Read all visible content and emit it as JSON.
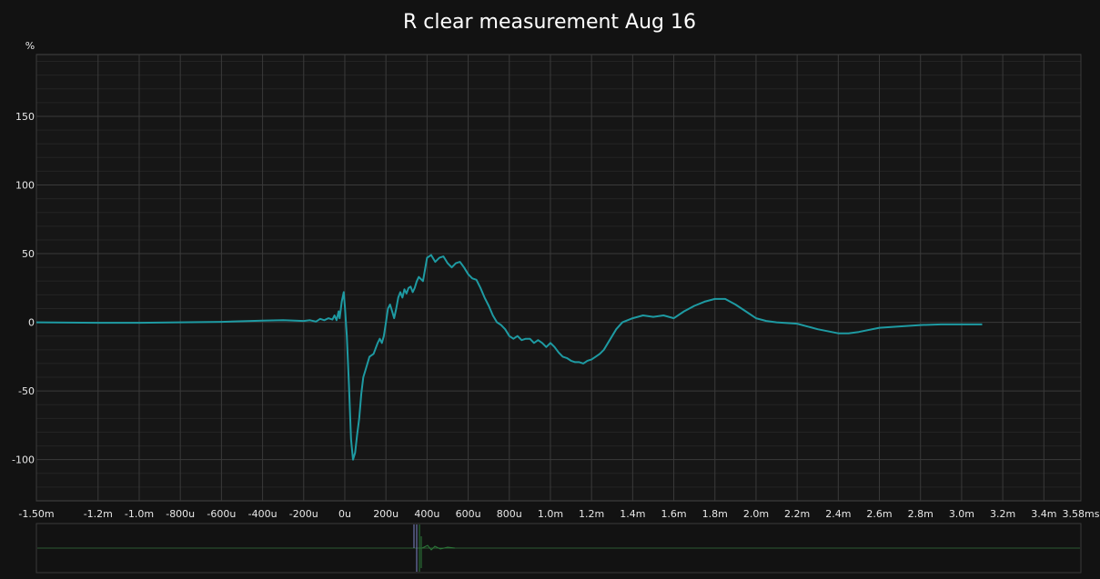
{
  "chart_data": {
    "type": "line",
    "title": "R clear measurement Aug 16",
    "ylabel": "%",
    "xlabel": "",
    "xlim_ms": [
      -1.5,
      3.58
    ],
    "ylim": [
      -130,
      195
    ],
    "grid": true,
    "colors": {
      "background": "#121212",
      "plot_background": "#161616",
      "grid_major": "#3a3a3a",
      "grid_minor": "#242424",
      "line": "#1e9aa2",
      "text": "#e8e8e8",
      "overview_line": "#2c7a3a",
      "overview_marker": "#7d86c8"
    },
    "x_ticks": [
      {
        "v": -1.5,
        "label": "-1.50m"
      },
      {
        "v": -1.2,
        "label": "-1.2m"
      },
      {
        "v": -1.0,
        "label": "-1.0m"
      },
      {
        "v": -0.8,
        "label": "-800u"
      },
      {
        "v": -0.6,
        "label": "-600u"
      },
      {
        "v": -0.4,
        "label": "-400u"
      },
      {
        "v": -0.2,
        "label": "-200u"
      },
      {
        "v": 0.0,
        "label": "0u"
      },
      {
        "v": 0.2,
        "label": "200u"
      },
      {
        "v": 0.4,
        "label": "400u"
      },
      {
        "v": 0.6,
        "label": "600u"
      },
      {
        "v": 0.8,
        "label": "800u"
      },
      {
        "v": 1.0,
        "label": "1.0m"
      },
      {
        "v": 1.2,
        "label": "1.2m"
      },
      {
        "v": 1.4,
        "label": "1.4m"
      },
      {
        "v": 1.6,
        "label": "1.6m"
      },
      {
        "v": 1.8,
        "label": "1.8m"
      },
      {
        "v": 2.0,
        "label": "2.0m"
      },
      {
        "v": 2.2,
        "label": "2.2m"
      },
      {
        "v": 2.4,
        "label": "2.4m"
      },
      {
        "v": 2.6,
        "label": "2.6m"
      },
      {
        "v": 2.8,
        "label": "2.8m"
      },
      {
        "v": 3.0,
        "label": "3.0m"
      },
      {
        "v": 3.2,
        "label": "3.2m"
      },
      {
        "v": 3.4,
        "label": "3.4m"
      },
      {
        "v": 3.58,
        "label": "3.58ms"
      }
    ],
    "y_ticks": [
      {
        "v": 150,
        "label": "150"
      },
      {
        "v": 100,
        "label": "100"
      },
      {
        "v": 50,
        "label": "50"
      },
      {
        "v": 0,
        "label": "0"
      },
      {
        "v": -50,
        "label": "-50"
      },
      {
        "v": -100,
        "label": "-100"
      }
    ],
    "series": [
      {
        "x": [
          -1.5,
          -1.2,
          -1.0,
          -0.6,
          -0.4,
          -0.3,
          -0.2,
          -0.17,
          -0.14,
          -0.12,
          -0.1,
          -0.08,
          -0.06,
          -0.05,
          -0.04,
          -0.03,
          -0.025,
          -0.015,
          -0.005,
          0.0,
          0.01,
          0.02,
          0.03,
          0.04,
          0.05,
          0.06,
          0.07,
          0.08,
          0.09,
          0.1,
          0.12,
          0.14,
          0.16,
          0.17,
          0.18,
          0.19,
          0.2,
          0.21,
          0.22,
          0.23,
          0.24,
          0.25,
          0.26,
          0.27,
          0.28,
          0.29,
          0.3,
          0.31,
          0.32,
          0.33,
          0.34,
          0.35,
          0.36,
          0.38,
          0.4,
          0.42,
          0.44,
          0.46,
          0.48,
          0.5,
          0.52,
          0.54,
          0.56,
          0.58,
          0.6,
          0.62,
          0.64,
          0.66,
          0.68,
          0.7,
          0.72,
          0.74,
          0.76,
          0.78,
          0.8,
          0.82,
          0.84,
          0.86,
          0.88,
          0.9,
          0.92,
          0.94,
          0.96,
          0.98,
          1.0,
          1.02,
          1.04,
          1.06,
          1.08,
          1.1,
          1.12,
          1.14,
          1.16,
          1.18,
          1.2,
          1.22,
          1.24,
          1.26,
          1.28,
          1.3,
          1.32,
          1.35,
          1.4,
          1.45,
          1.5,
          1.55,
          1.6,
          1.65,
          1.7,
          1.75,
          1.8,
          1.85,
          1.9,
          1.95,
          2.0,
          2.05,
          2.1,
          2.2,
          2.3,
          2.4,
          2.45,
          2.5,
          2.6,
          2.7,
          2.8,
          2.9,
          3.0,
          3.1
        ],
        "y": [
          0,
          -0.3,
          -0.3,
          0.3,
          1.2,
          1.5,
          1.0,
          1.5,
          0.5,
          2.5,
          1.5,
          3,
          2,
          5,
          1.5,
          8,
          3,
          15,
          22,
          12,
          -10,
          -45,
          -85,
          -100,
          -95,
          -82,
          -70,
          -52,
          -40,
          -35,
          -25,
          -23,
          -15,
          -12,
          -15,
          -10,
          0,
          10,
          13,
          8,
          3,
          10,
          18,
          22,
          18,
          24,
          21,
          25,
          26,
          22,
          25,
          30,
          33,
          30,
          47,
          49,
          44,
          47,
          48,
          43,
          40,
          43,
          44,
          40,
          35,
          32,
          31,
          25,
          18,
          12,
          5,
          0,
          -2,
          -5,
          -10,
          -12,
          -10,
          -13,
          -12,
          -12,
          -15,
          -13,
          -15,
          -18,
          -15,
          -18,
          -22,
          -25,
          -26,
          -28,
          -29,
          -29,
          -30,
          -28,
          -27,
          -25,
          -23,
          -20,
          -15,
          -10,
          -5,
          0,
          3,
          5,
          4,
          5,
          3,
          8,
          12,
          15,
          17,
          17,
          13,
          8,
          3,
          1,
          0,
          -1,
          -5,
          -8,
          -8,
          -7,
          -4,
          -3,
          -2,
          -1.5,
          -1.5,
          -1.5
        ]
      }
    ]
  }
}
